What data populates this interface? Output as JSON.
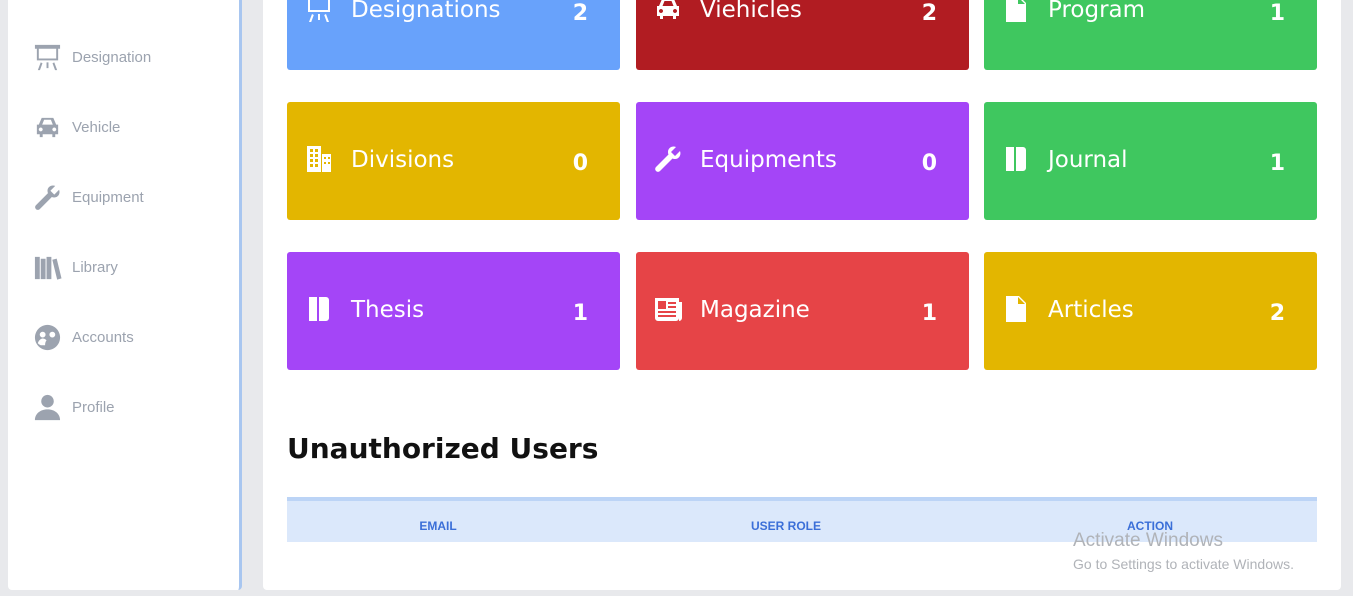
{
  "sidebar": {
    "items": [
      {
        "label": "Designation",
        "icon": "easel-icon"
      },
      {
        "label": "Vehicle",
        "icon": "car-icon"
      },
      {
        "label": "Equipment",
        "icon": "wrench-icon"
      },
      {
        "label": "Library",
        "icon": "books-icon"
      },
      {
        "label": "Accounts",
        "icon": "users-circle-icon"
      },
      {
        "label": "Profile",
        "icon": "user-icon"
      }
    ]
  },
  "cards": [
    {
      "label": "Designations",
      "count": "2",
      "color": "#68a2fb",
      "icon": "easel-icon"
    },
    {
      "label": "Viehicles",
      "count": "2",
      "color": "#b11c22",
      "icon": "car-icon"
    },
    {
      "label": "Program",
      "count": "1",
      "color": "#3fc75f",
      "icon": "file-icon"
    },
    {
      "label": "Divisions",
      "count": "0",
      "color": "#e3b600",
      "icon": "building-icon"
    },
    {
      "label": "Equipments",
      "count": "0",
      "color": "#a445f7",
      "icon": "wrench-icon"
    },
    {
      "label": "Journal",
      "count": "1",
      "color": "#3fc75f",
      "icon": "journal-icon"
    },
    {
      "label": "Thesis",
      "count": "1",
      "color": "#a445f7",
      "icon": "journal-icon"
    },
    {
      "label": "Magazine",
      "count": "1",
      "color": "#e64447",
      "icon": "newspaper-icon"
    },
    {
      "label": "Articles",
      "count": "2",
      "color": "#e3b600",
      "icon": "file-icon"
    }
  ],
  "section": {
    "title": "Unauthorized Users"
  },
  "table": {
    "headers": [
      "EMAIL",
      "USER ROLE",
      "ACTION"
    ]
  },
  "watermark": {
    "line1": "Activate Windows",
    "line2": "Go to Settings to activate Windows."
  }
}
